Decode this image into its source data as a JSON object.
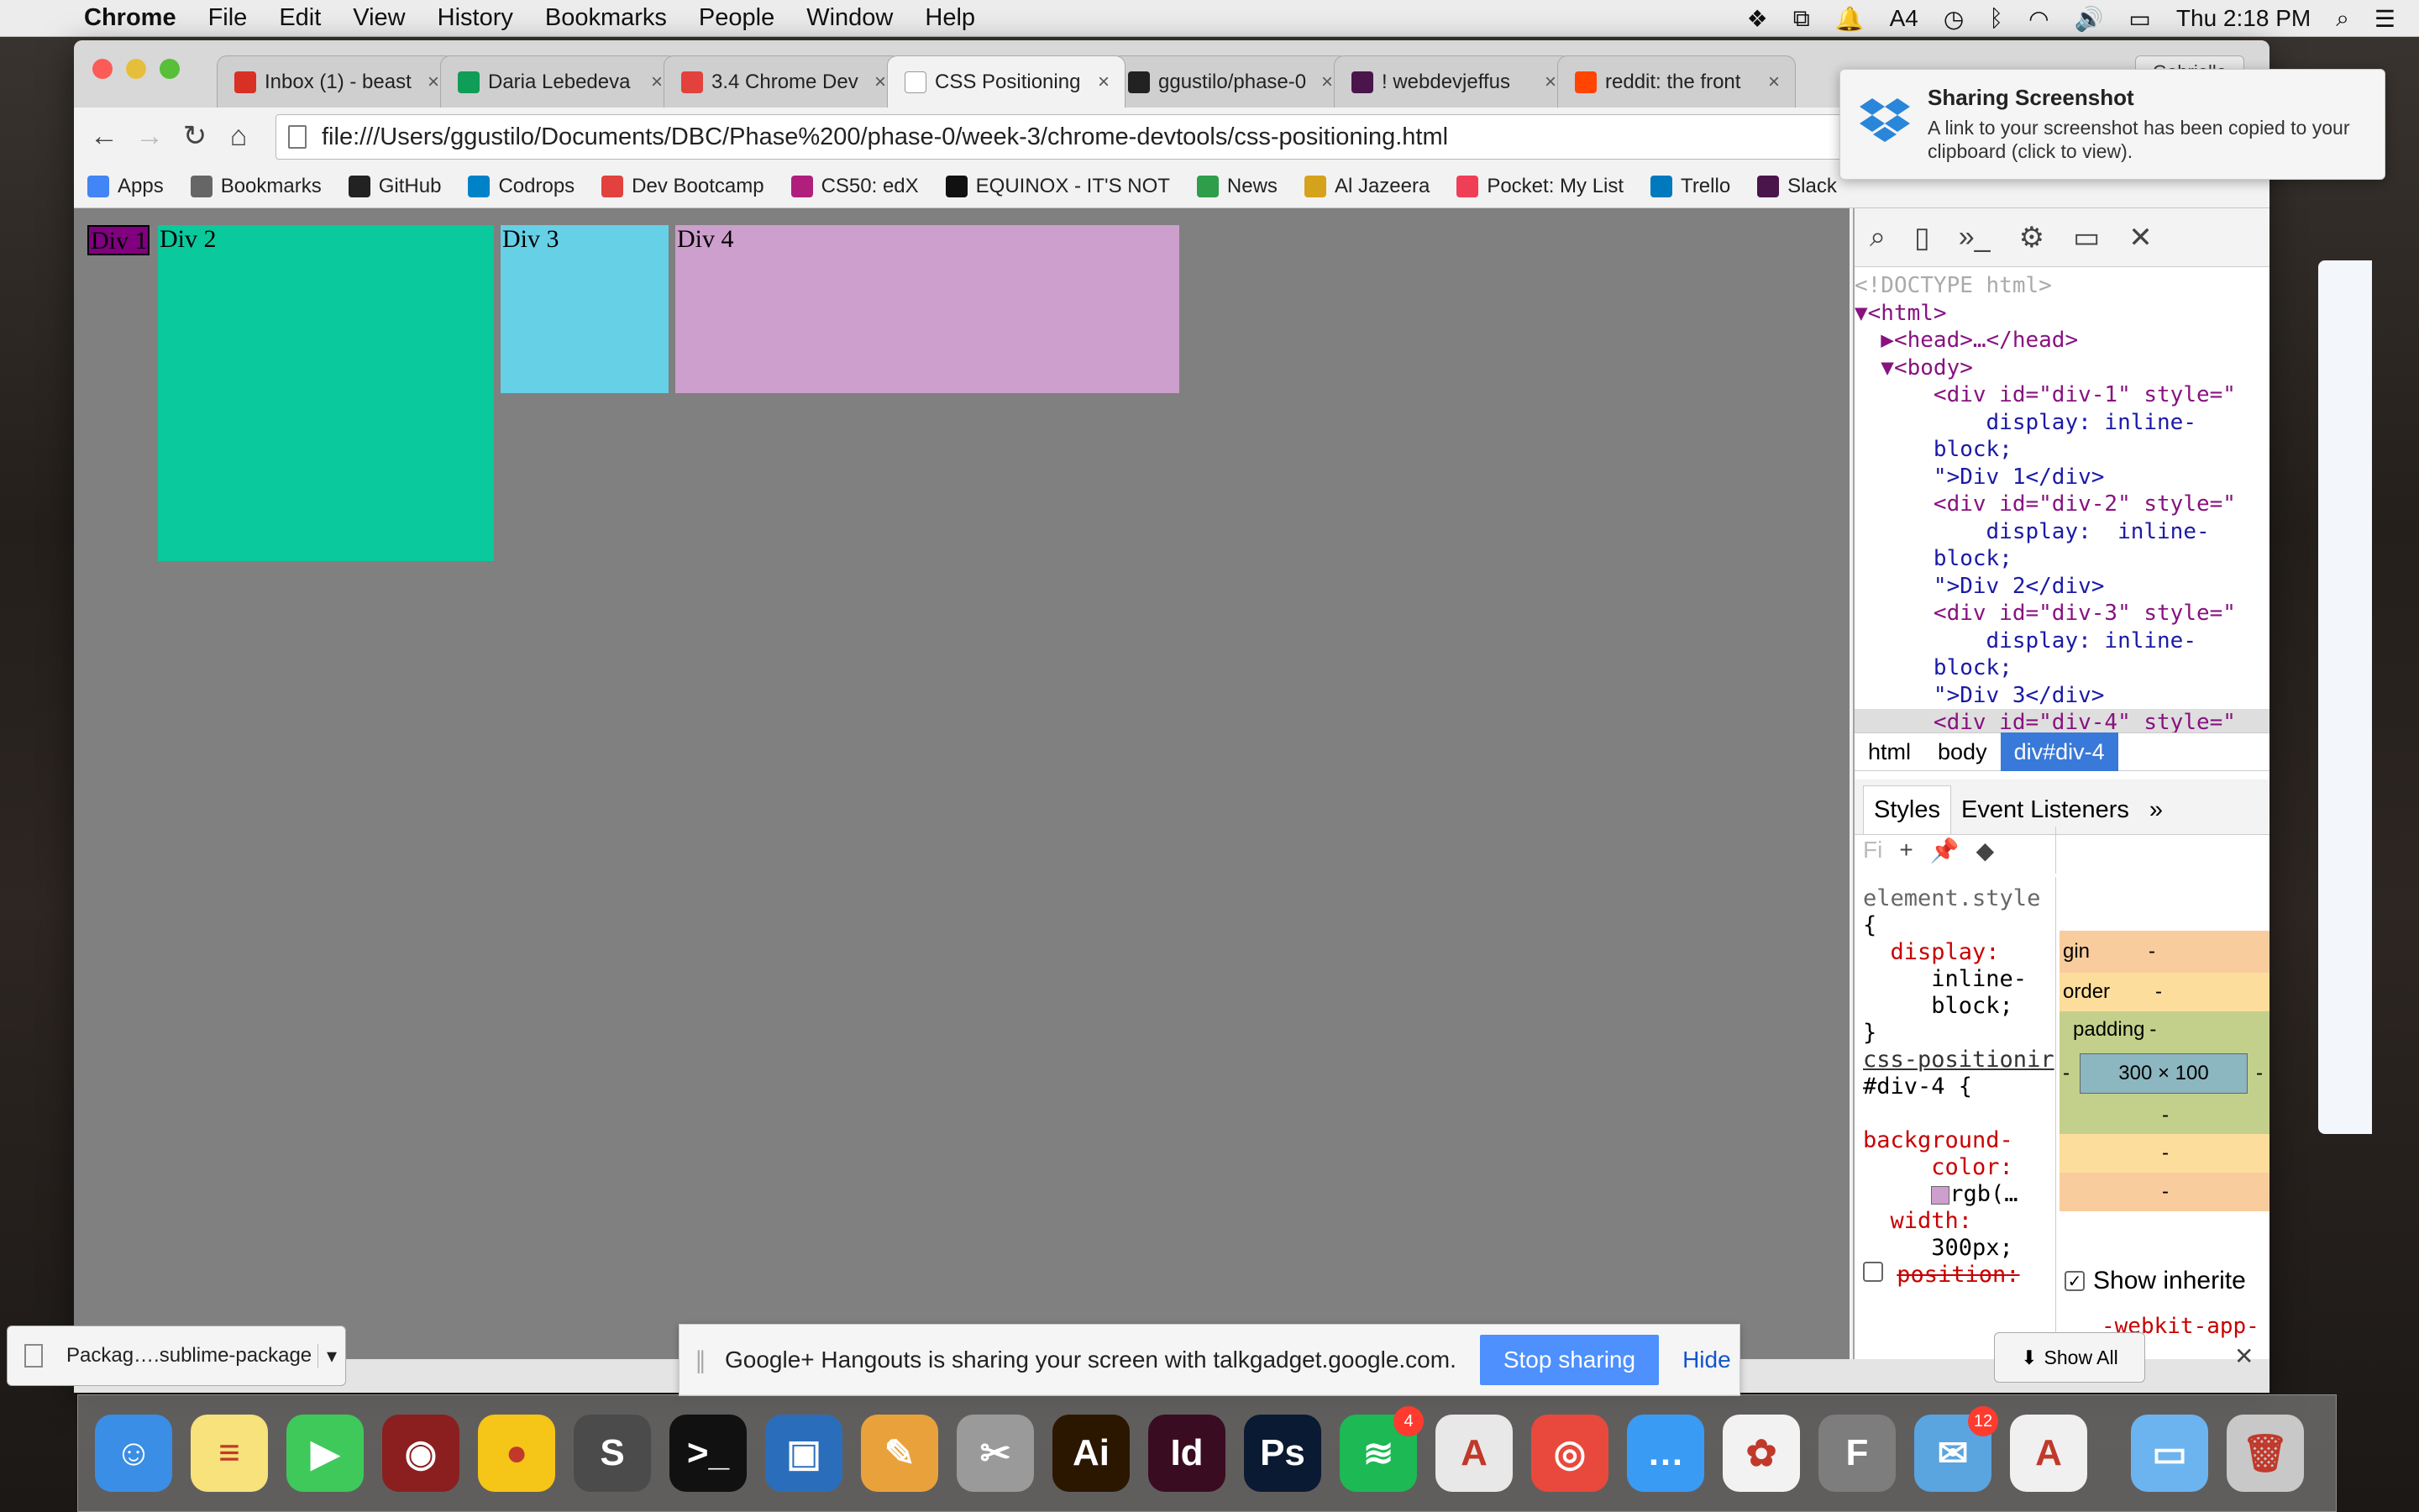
{
  "menubar": {
    "app": "Chrome",
    "items": [
      "File",
      "Edit",
      "View",
      "History",
      "Bookmarks",
      "People",
      "Window",
      "Help"
    ],
    "status_badge": "4",
    "clock": "Thu 2:18 PM"
  },
  "tabs": [
    {
      "label": "Inbox (1) - beast",
      "icon": "gmail-icon",
      "color": "#d93025"
    },
    {
      "label": "Daria Lebedeva",
      "icon": "hangouts-icon",
      "color": "#0f9d58"
    },
    {
      "label": "3.4 Chrome Dev",
      "icon": "dbc-icon",
      "color": "#e2413d"
    },
    {
      "label": "CSS Positioning",
      "icon": "page-icon",
      "color": "#ffffff"
    },
    {
      "label": "ggustilo/phase-0",
      "icon": "github-icon",
      "color": "#222222"
    },
    {
      "label": "! webdevjeffus",
      "icon": "slack-icon",
      "color": "#4a154b"
    },
    {
      "label": "reddit: the front",
      "icon": "reddit-icon",
      "color": "#ff4500"
    }
  ],
  "profile": "Gabrielle",
  "address": "file:///Users/ggustilo/Documents/DBC/Phase%200/phase-0/week-3/chrome-devtools/css-positioning.html",
  "bookmarks": [
    {
      "label": "Apps",
      "icon": "apps-icon",
      "color": "#4285f4"
    },
    {
      "label": "Bookmarks",
      "icon": "star-icon",
      "color": "#666666"
    },
    {
      "label": "GitHub",
      "icon": "github-icon",
      "color": "#222222"
    },
    {
      "label": "Codrops",
      "icon": "codrops-icon",
      "color": "#0082c9"
    },
    {
      "label": "Dev Bootcamp",
      "icon": "dbc-icon",
      "color": "#e2413d"
    },
    {
      "label": "CS50: edX",
      "icon": "edx-icon",
      "color": "#b01f7c"
    },
    {
      "label": "EQUINOX - IT'S NOT",
      "icon": "equinox-icon",
      "color": "#111111"
    },
    {
      "label": "News",
      "icon": "news-icon",
      "color": "#2e9e4b"
    },
    {
      "label": "Al Jazeera",
      "icon": "aljazeera-icon",
      "color": "#d5a21b"
    },
    {
      "label": "Pocket: My List",
      "icon": "pocket-icon",
      "color": "#ef3f56"
    },
    {
      "label": "Trello",
      "icon": "trello-icon",
      "color": "#0079bf"
    },
    {
      "label": "Slack",
      "icon": "slack-icon",
      "color": "#4a154b"
    }
  ],
  "page": {
    "div1": "Div 1",
    "div2": "Div 2",
    "div3": "Div 3",
    "div4": "Div 4"
  },
  "devtools": {
    "dom_lines": [
      "<!DOCTYPE html>",
      "▼<html>",
      "  ▶<head>…</head>",
      "  ▼<body>",
      "      <div id=\"div-1\" style=\"",
      "          display: inline-",
      "      block;",
      "      \">Div 1</div>",
      "      <div id=\"div-2\" style=\"",
      "          display:  inline-",
      "      block;",
      "      \">Div 2</div>",
      "      <div id=\"div-3\" style=\"",
      "          display: inline-",
      "      block;",
      "      \">Div 3</div>",
      "      <div id=\"div-4\" style=\""
    ],
    "breadcrumbs": [
      "html",
      "body",
      "div#div-4"
    ],
    "panel_tabs": [
      "Styles",
      "Event Listeners"
    ],
    "filter_placeholder": "Fi",
    "styles": {
      "element_style": "element.style",
      "open": "{",
      "prop1": "display:",
      "val1a": "inline-",
      "val1b": "block;",
      "close": "}",
      "source": "css-positionir",
      "selector": "#div-4 {",
      "prop2a": "background-",
      "prop2b": "color:",
      "val2": "rgb(…",
      "swatch": "#cc9fcc",
      "prop3": "width:",
      "val3": "300px;",
      "prop4": "position:"
    },
    "boxmodel": {
      "margin": "gin",
      "border": "order",
      "padding": "padding",
      "content": "300 × 100",
      "dash": "-"
    },
    "show_inherited": "Show inherite",
    "webkit_app": "-webkit-app-"
  },
  "download": {
    "file": "Packag….sublime-package",
    "show_all": "Show All"
  },
  "hangouts": {
    "message": "Google+ Hangouts is sharing your screen with talkgadget.google.com.",
    "stop": "Stop sharing",
    "hide": "Hide"
  },
  "notification": {
    "title": "Sharing Screenshot",
    "body": "A link to your screenshot has been copied to your clipboard (click to view)."
  },
  "dock": [
    {
      "name": "finder",
      "glyph": "☺",
      "color": "#3a8ee6"
    },
    {
      "name": "notes",
      "glyph": "≡",
      "color": "#f7e27b"
    },
    {
      "name": "facetime",
      "glyph": "▶",
      "color": "#3ec95a"
    },
    {
      "name": "photo-booth",
      "glyph": "◉",
      "color": "#8b1f1f"
    },
    {
      "name": "cyberduck",
      "glyph": "●",
      "color": "#f5c518"
    },
    {
      "name": "sublime",
      "glyph": "S",
      "color": "#4b4b4b"
    },
    {
      "name": "terminal",
      "glyph": ">_",
      "color": "#111111"
    },
    {
      "name": "virtualbox",
      "glyph": "▣",
      "color": "#2a6ebb"
    },
    {
      "name": "pages",
      "glyph": "✎",
      "color": "#e9a23b"
    },
    {
      "name": "scissors",
      "glyph": "✂",
      "color": "#9a9a9a"
    },
    {
      "name": "illustrator",
      "glyph": "Ai",
      "color": "#2b1700"
    },
    {
      "name": "indesign",
      "glyph": "Id",
      "color": "#3a0c22"
    },
    {
      "name": "photoshop",
      "glyph": "Ps",
      "color": "#0b1a33"
    },
    {
      "name": "spotify",
      "glyph": "≋",
      "color": "#1db954",
      "badge": "4"
    },
    {
      "name": "acrobat",
      "glyph": "A",
      "color": "#e8e8e8"
    },
    {
      "name": "chrome",
      "glyph": "◎",
      "color": "#e9493c"
    },
    {
      "name": "messages",
      "glyph": "…",
      "color": "#3a9bf5"
    },
    {
      "name": "photos",
      "glyph": "✿",
      "color": "#f2f2f2"
    },
    {
      "name": "fontbook",
      "glyph": "F",
      "color": "#7d7d7d"
    },
    {
      "name": "mail",
      "glyph": "✉",
      "color": "#5aa4e0",
      "badge": "12"
    },
    {
      "name": "acrobat-reader",
      "glyph": "A",
      "color": "#f0f0f0"
    },
    {
      "name": "downloads-folder",
      "glyph": "▭",
      "color": "#6cb4f0"
    },
    {
      "name": "trash",
      "glyph": "🗑",
      "color": "#c8c8c8"
    }
  ]
}
